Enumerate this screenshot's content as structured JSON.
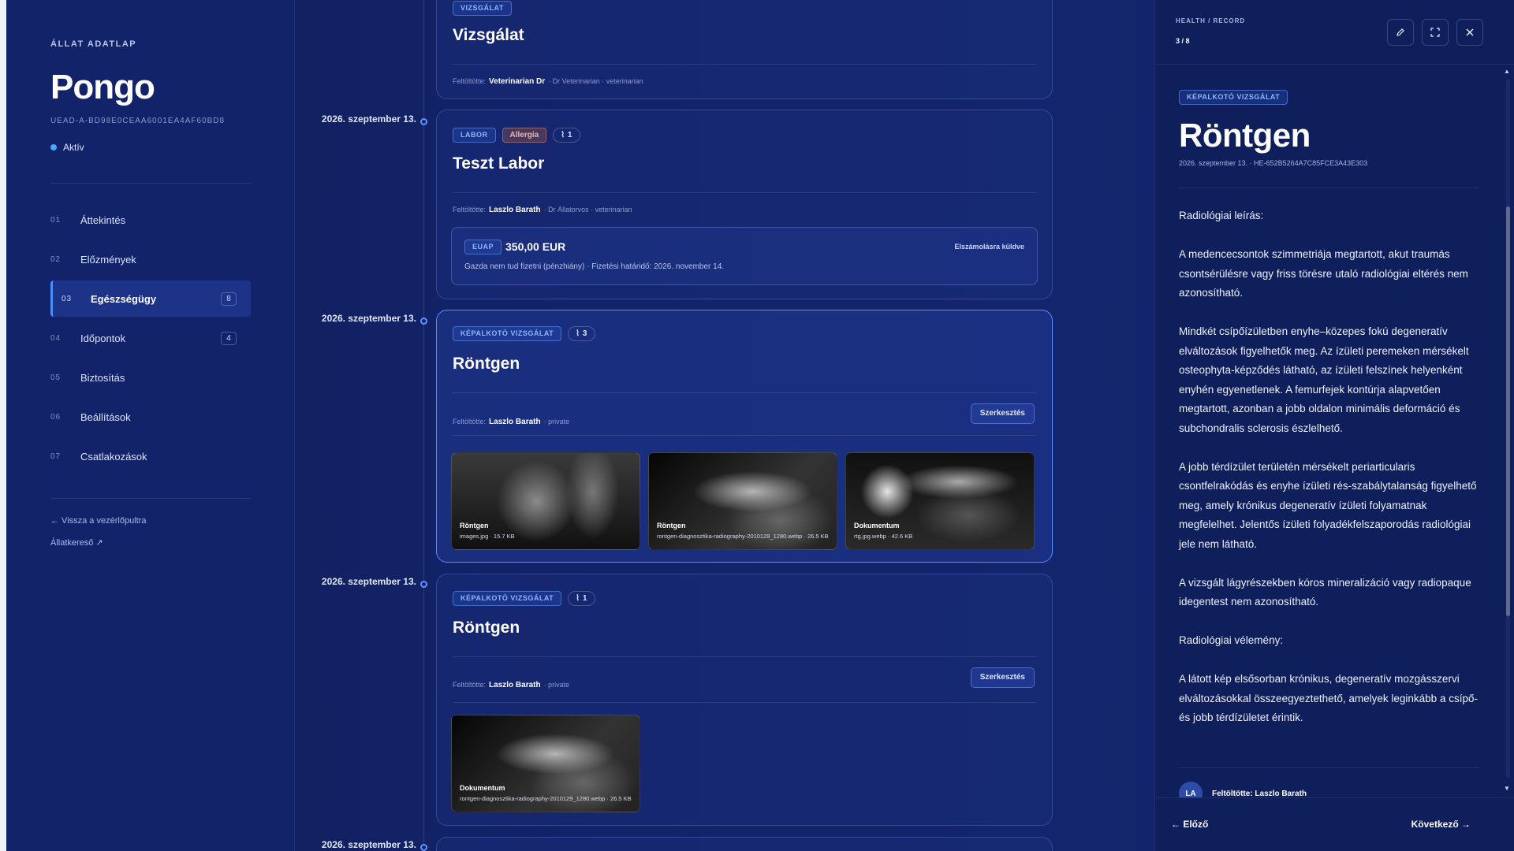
{
  "sidebar": {
    "eyebrow": "ÁLLAT ADATLAP",
    "pet_name": "Pongo",
    "pet_id": "UEAD-A-BD98E0CEAA6001EA4AF60BD8",
    "status": "Aktív",
    "items": [
      {
        "num": "01",
        "label": "Áttekintés",
        "badge": ""
      },
      {
        "num": "02",
        "label": "Előzmények",
        "badge": ""
      },
      {
        "num": "03",
        "label": "Egészségügy",
        "badge": "8"
      },
      {
        "num": "04",
        "label": "Időpontok",
        "badge": "4"
      },
      {
        "num": "05",
        "label": "Biztosítás",
        "badge": ""
      },
      {
        "num": "06",
        "label": "Beállítások",
        "badge": ""
      },
      {
        "num": "07",
        "label": "Csatlakozások",
        "badge": ""
      }
    ],
    "back_link": "← Vissza a vezérlőpultra",
    "search_link": "Állatkereső ↗"
  },
  "timeline": {
    "uploader_prefix": "Feltöltötte:",
    "edit_label": "Szerkesztés",
    "cards": [
      {
        "date": "",
        "tag": "VIZSGÁLAT",
        "title": "Vizsgálat",
        "uploader": "Veterinarian Dr",
        "uploader_meta": "· Dr Veterinarian · veterinarian"
      },
      {
        "date": "2026. szeptember 13.",
        "tag": "LABOR",
        "tag2": "Allergia",
        "clips": "1",
        "title": "Teszt Labor",
        "uploader": "Laszlo Barath",
        "uploader_meta": "· Dr Állatorvos · veterinarian",
        "invoice": {
          "tag": "EUAP",
          "amount": "350,00 EUR",
          "status": "Elszámolásra küldve",
          "note": "Gazda nem tud fizetni (pénzhiány) · Fizetési határidő: 2026. november 14."
        }
      },
      {
        "date": "2026. szeptember 13.",
        "tag": "KÉPALKOTÓ VIZSGÁLAT",
        "clips": "3",
        "title": "Röntgen",
        "uploader": "Laszlo Barath",
        "uploader_meta": "· private",
        "thumbs": [
          {
            "title": "Röntgen",
            "file": "images.jpg · 15.7 KB"
          },
          {
            "title": "Röntgen",
            "file": "rontgen-diagnosztika-radiography-2010129_1280.webp · 26.5 KB"
          },
          {
            "title": "Dokumentum",
            "file": "rtg.jpg.webp · 42.6 KB"
          }
        ]
      },
      {
        "date": "2026. szeptember 13.",
        "tag": "KÉPALKOTÓ VIZSGÁLAT",
        "clips": "1",
        "title": "Röntgen",
        "uploader": "Laszlo Barath",
        "uploader_meta": "· private",
        "thumbs": [
          {
            "title": "Dokumentum",
            "file": "rontgen-diagnosztika-radiography-2010129_1280.webp · 26.5 KB"
          }
        ]
      },
      {
        "date": "2026. szeptember 13."
      }
    ]
  },
  "panel": {
    "crumb": "HEALTH / RECORD",
    "count": "3 / 8",
    "icons": [
      "pencil-icon",
      "expand-icon",
      "close-icon"
    ],
    "tag": "KÉPALKOTÓ VIZSGÁLAT",
    "title": "Röntgen",
    "meta": "2026. szeptember 13. · HE-652B5264A7C85FCE3A43E303",
    "paragraphs": [
      "Radiológiai leírás:",
      "A medencecsontok szimmetriája megtartott, akut traumás csontsérülésre vagy friss törésre utaló radiológiai eltérés nem azonosítható.",
      "Mindkét csípőízületben enyhe–közepes fokú degeneratív elváltozások figyelhetők meg. Az ízületi peremeken mérsékelt osteophyta-képződés látható, az ízületi felszínek helyenként enyhén egyenetlenek. A femurfejek kontúrja alapvetően megtartott, azonban a jobb oldalon minimális deformáció és subchondralis sclerosis észlelhető.",
      "A jobb térdízület területén mérsékelt periarticularis csontfelrakódás és enyhe ízületi rés-szabálytalanság figyelhető meg, amely krónikus degeneratív ízületi folyamatnak megfelelhet. Jelentős ízületi folyadékfelszaporodás radiológiai jele nem látható.",
      "A vizsgált lágyrészekben kóros mineralizáció vagy radiopaque idegentest nem azonosítható.",
      "Radiológiai vélemény:",
      "A látott kép elsősorban krónikus, degeneratív mozgásszervi elváltozásokkal összeegyeztethető, amelyek leginkább a csípő- és jobb térdízületet érintik."
    ],
    "uploader_label": "Feltöltötte: Laszlo Barath",
    "avatar_initials": "LA",
    "prev_label": "← Előző",
    "next_label": "Következő →"
  }
}
